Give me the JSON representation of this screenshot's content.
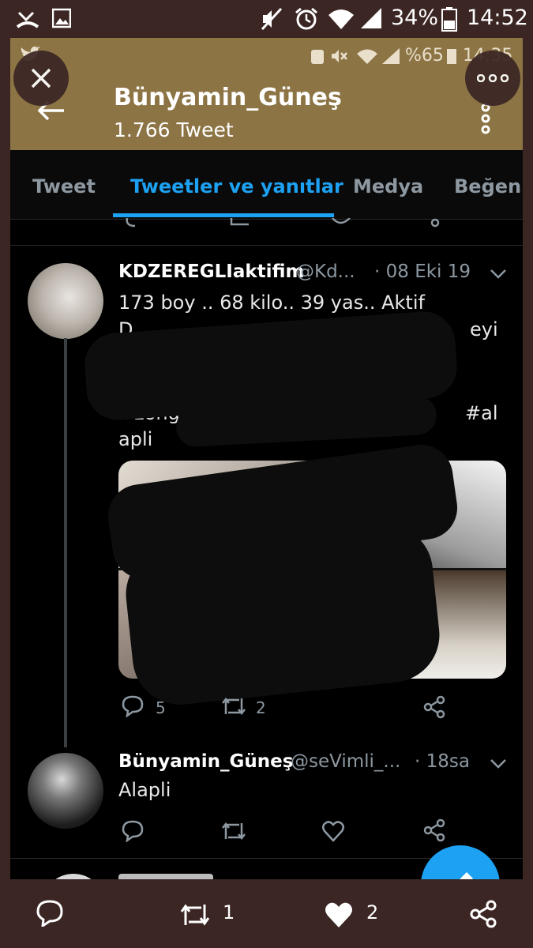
{
  "outer_status": {
    "battery": "34%",
    "time": "14:52"
  },
  "inner_status": {
    "battery": "%65",
    "time": "14:35"
  },
  "header": {
    "title": "Bünyamin_Güneş",
    "subtitle": "1.766 Tweet"
  },
  "tabs": [
    {
      "label": "Tweet",
      "active": false
    },
    {
      "label": "Tweetler ve yanıtlar",
      "active": true
    },
    {
      "label": "Medya",
      "active": false
    },
    {
      "label": "Beğenil",
      "active": false
    }
  ],
  "tweets": [
    {
      "name": "KDZEREGLIaktifim",
      "handle": "@Kd...",
      "time": "· 08 Eki 19",
      "lines": [
        "173 boy .. 68 kilo.. 39 yas.. Aktif",
        "D",
        "eyi",
        "#zong",
        "#al",
        "apli"
      ],
      "reply_count": "5",
      "retweet_count": "2"
    },
    {
      "name": "Bünyamin_Güneş",
      "handle": "@seVimli_...",
      "time": "· 18sa",
      "lines": [
        "Alapli"
      ]
    }
  ],
  "bottom_bar": {
    "retweet_count": "1",
    "like_count": "2"
  },
  "colors": {
    "accent": "#1da1f2",
    "header_bg": "#8c7444",
    "outer_bg": "#3b2624"
  }
}
